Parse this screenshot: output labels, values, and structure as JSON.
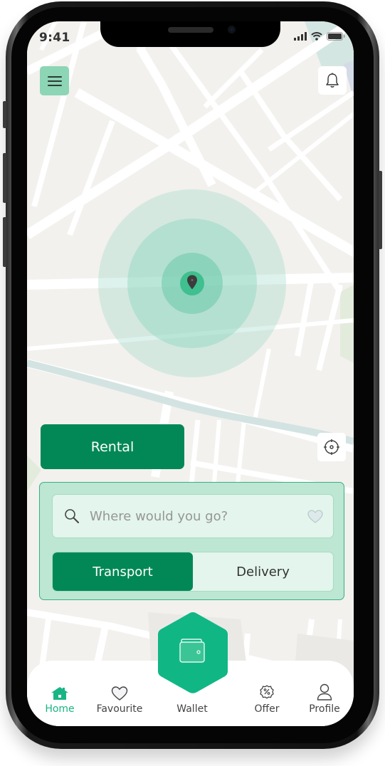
{
  "status_bar": {
    "time": "9:41"
  },
  "colors": {
    "accent": "#028856",
    "accent_light": "#8cd5b5",
    "panel_bg": "#bde6d3",
    "hex": "#10b784",
    "tab_active": "#18b584"
  },
  "header": {
    "menu_icon": "hamburger-icon",
    "notification_icon": "bell-icon"
  },
  "map": {
    "pin_icon": "map-pin-icon",
    "locate_icon": "crosshair-icon"
  },
  "actions": {
    "rental_label": "Rental"
  },
  "search": {
    "placeholder": "Where would you go?",
    "value": "",
    "icon": "search-icon",
    "favorite_icon": "heart-icon"
  },
  "mode_toggle": {
    "options": [
      {
        "label": "Transport",
        "active": true
      },
      {
        "label": "Delivery",
        "active": false
      }
    ]
  },
  "tabbar": {
    "items": [
      {
        "label": "Home",
        "icon": "home-icon",
        "active": true
      },
      {
        "label": "Favourite",
        "icon": "heart-icon",
        "active": false
      },
      {
        "label": "Wallet",
        "icon": "wallet-icon",
        "active": false
      },
      {
        "label": "Offer",
        "icon": "discount-badge-icon",
        "active": false
      },
      {
        "label": "Profile",
        "icon": "user-icon",
        "active": false
      }
    ]
  }
}
